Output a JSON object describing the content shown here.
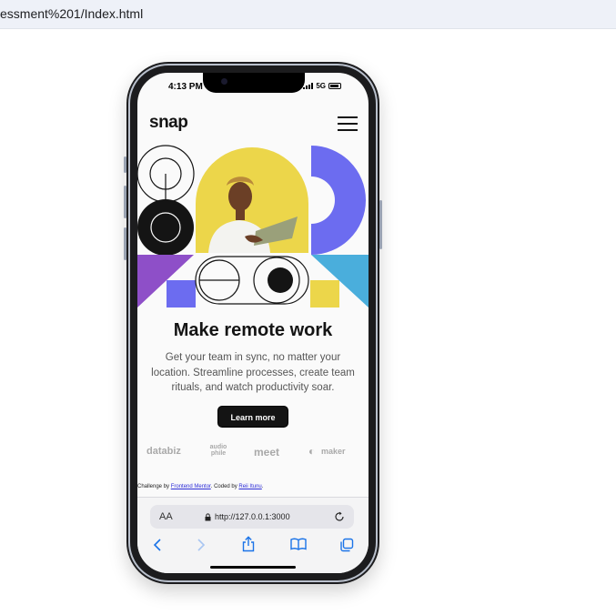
{
  "browser": {
    "url_fragment": "essment%201/Index.html"
  },
  "phone": {
    "status": {
      "time": "4:13 PM",
      "network": "5G"
    }
  },
  "site": {
    "logo": "snap",
    "menu_icon": "hamburger-menu-icon",
    "headline": "Make remote work",
    "subtitle": "Get your team in sync, no matter your location. Streamline processes, create team rituals, and watch productivity soar.",
    "cta_label": "Learn more",
    "clients": [
      "databiz",
      "audio phile",
      "meet",
      "maker"
    ],
    "attribution": {
      "prefix": "Challenge by ",
      "link1": "Frontend Mentor",
      "middle": ". Coded by ",
      "link2": "Reii Itunu",
      "suffix": "."
    }
  },
  "safari": {
    "aa_label": "AA",
    "url": "http://127.0.0.1:3000",
    "reload_icon": "reload-icon",
    "toolbar_icons": [
      "back-icon",
      "forward-icon",
      "share-icon",
      "bookmarks-icon",
      "tabs-icon"
    ]
  },
  "colors": {
    "yellow": "#ecd64a",
    "purple": "#8e4fc8",
    "periwinkle": "#6c6cf0",
    "sky": "#4aaedc",
    "dark": "#141414"
  }
}
